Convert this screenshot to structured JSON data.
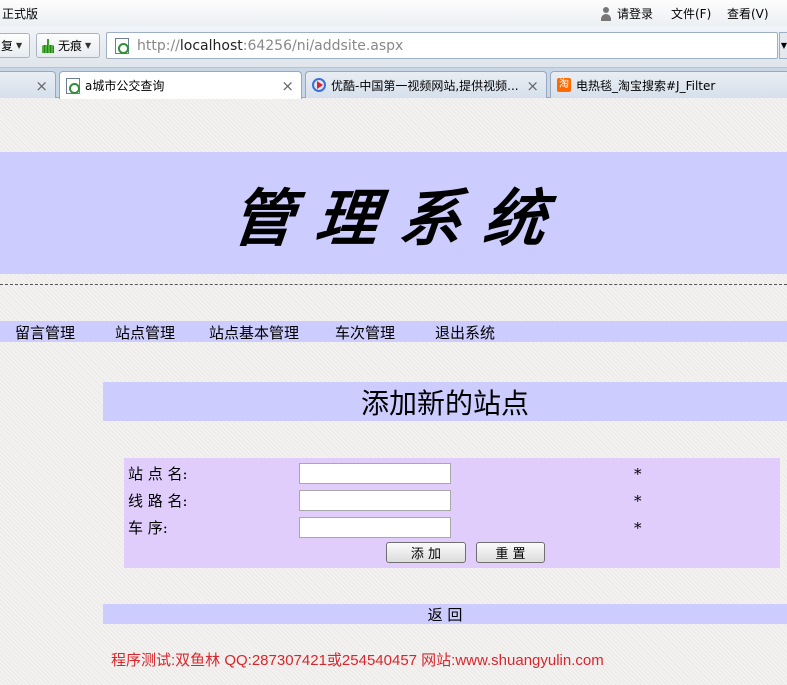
{
  "browser": {
    "edition": "正式版",
    "login": "请登录",
    "menu_file": "文件(F)",
    "menu_view": "查看(V)",
    "restore_label": "复",
    "private_label": "无痕",
    "url_scheme": "http://",
    "url_host": "localhost",
    "url_rest": ":64256/ni/addsite.aspx",
    "tabs": [
      {
        "title": ""
      },
      {
        "title": "a城市公交查询"
      },
      {
        "title": "优酷-中国第一视频网站,提供视频..."
      },
      {
        "title": "电热毯_淘宝搜索#J_Filter"
      }
    ],
    "close_glyph": "×",
    "taobao_glyph": "淘"
  },
  "page": {
    "banner_title": "管理系统",
    "nav": [
      {
        "label": "留言管理"
      },
      {
        "label": "站点管理"
      },
      {
        "label": "站点基本管理"
      },
      {
        "label": "车次管理"
      },
      {
        "label": "退出系统"
      }
    ],
    "heading": "添加新的站点",
    "form": {
      "fields": [
        {
          "label": "站 点 名:",
          "value": "",
          "required": "*"
        },
        {
          "label": "线 路 名:",
          "value": "",
          "required": "*"
        },
        {
          "label": "车  序:",
          "value": "",
          "required": "*"
        }
      ],
      "add_button": "添   加",
      "reset_button": "重   置"
    },
    "return_link": "返 回",
    "footer": "程序测试:双鱼林 QQ:287307421或254540457 网站:www.shuangyulin.com"
  },
  "colors": {
    "banner_bg": "#ccccff",
    "form_bg": "#e0cdfc",
    "footer_text": "#d9262b"
  }
}
